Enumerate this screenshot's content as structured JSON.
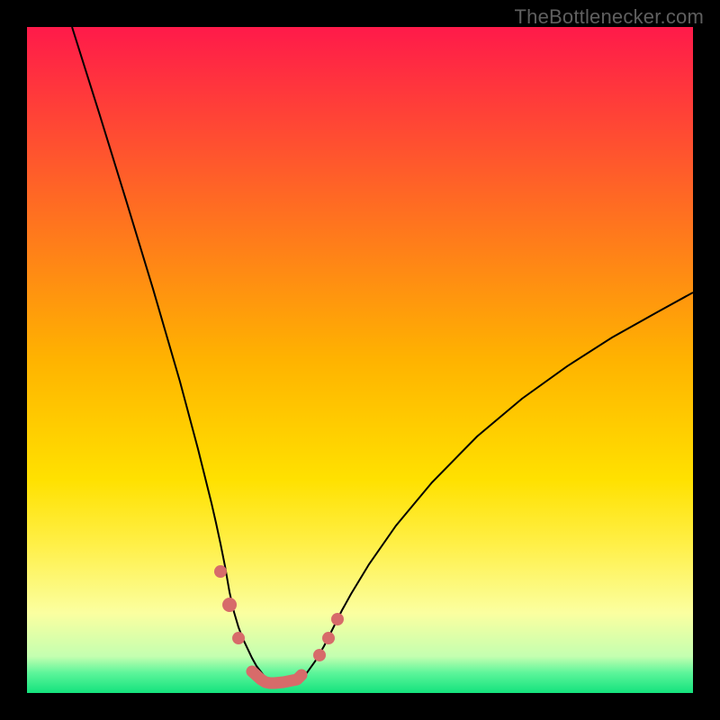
{
  "watermark": "TheBottlenecker.com",
  "chart_data": {
    "type": "line",
    "title": "",
    "xlabel": "",
    "ylabel": "",
    "xlim": [
      0,
      100
    ],
    "ylim": [
      0,
      100
    ],
    "grid": false,
    "legend": false,
    "background_gradient": {
      "stops": [
        {
          "offset": 0.0,
          "color": "#ff1a4a"
        },
        {
          "offset": 0.5,
          "color": "#ffb300"
        },
        {
          "offset": 0.68,
          "color": "#ffe100"
        },
        {
          "offset": 0.78,
          "color": "#fff04a"
        },
        {
          "offset": 0.88,
          "color": "#fbffa0"
        },
        {
          "offset": 0.945,
          "color": "#c4ffb0"
        },
        {
          "offset": 0.97,
          "color": "#5cf59a"
        },
        {
          "offset": 1.0,
          "color": "#14e27d"
        }
      ]
    },
    "series": [
      {
        "name": "left-arm",
        "color": "#000000",
        "width": 2,
        "x": [
          6.76,
          10.81,
          14.86,
          18.92,
          22.97,
          25.68,
          27.7,
          28.38,
          29.05,
          29.73,
          30.41,
          31.08,
          31.76,
          32.43,
          33.78,
          34.46,
          35.81
        ],
        "y": [
          100.0,
          87.16,
          74.05,
          60.68,
          46.76,
          36.62,
          28.51,
          25.54,
          22.43,
          19.05,
          15.14,
          12.16,
          9.86,
          8.11,
          5.27,
          4.05,
          2.3
        ]
      },
      {
        "name": "right-arm",
        "color": "#000000",
        "width": 2,
        "x": [
          41.89,
          43.24,
          44.59,
          45.27,
          45.95,
          47.3,
          48.65,
          51.35,
          55.41,
          60.81,
          67.57,
          74.32,
          81.08,
          87.84,
          94.59,
          100.0
        ],
        "y": [
          2.84,
          4.73,
          7.03,
          8.38,
          9.73,
          12.43,
          14.86,
          19.32,
          25.14,
          31.62,
          38.51,
          44.19,
          49.05,
          53.38,
          57.16,
          60.14
        ]
      },
      {
        "name": "floor",
        "color": "#d76b6a",
        "width": 13,
        "linecap": "round",
        "x": [
          33.78,
          35.14,
          35.81,
          36.49,
          37.16,
          38.51,
          40.54,
          41.22
        ],
        "y": [
          3.24,
          2.03,
          1.62,
          1.49,
          1.49,
          1.62,
          2.03,
          2.7
        ]
      }
    ],
    "markers": [
      {
        "x": 29.05,
        "y": 18.24,
        "r": 7.0,
        "color": "#d76b6a"
      },
      {
        "x": 30.41,
        "y": 13.24,
        "r": 8.0,
        "color": "#d76b6a"
      },
      {
        "x": 31.76,
        "y": 8.24,
        "r": 7.0,
        "color": "#d76b6a"
      },
      {
        "x": 43.92,
        "y": 5.68,
        "r": 7.0,
        "color": "#d76b6a"
      },
      {
        "x": 45.27,
        "y": 8.24,
        "r": 7.0,
        "color": "#d76b6a"
      },
      {
        "x": 46.62,
        "y": 11.08,
        "r": 7.0,
        "color": "#d76b6a"
      }
    ]
  }
}
